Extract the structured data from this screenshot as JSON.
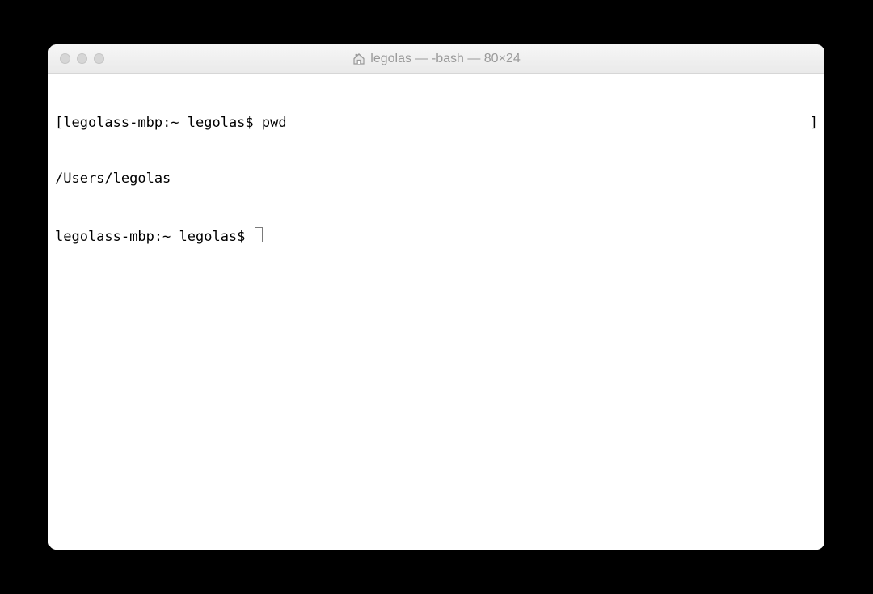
{
  "window": {
    "title": "legolas — -bash — 80×24"
  },
  "terminal": {
    "line1": {
      "open_bracket": "[",
      "prompt": "legolass-mbp:~ legolas$ ",
      "command": "pwd",
      "close_bracket": "]"
    },
    "line2": {
      "output": "/Users/legolas"
    },
    "line3": {
      "prompt": "legolass-mbp:~ legolas$ "
    }
  }
}
